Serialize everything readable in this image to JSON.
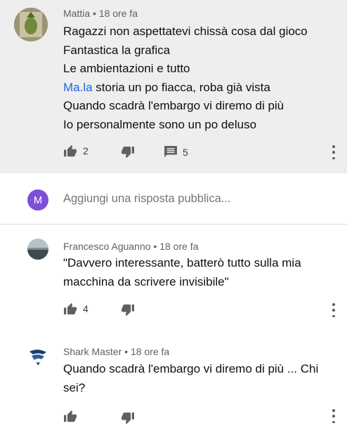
{
  "comments": [
    {
      "author": "Mattia",
      "time": "18 ore fa",
      "lines": [
        "Ragazzi non aspettatevi chissà cosa dal gioco",
        "Fantastica la grafica",
        "Le ambientazioni e tutto",
        "Ma.la storia un po fiacca, roba già vista",
        "Quando scadrà l'embargo vi diremo di più",
        "Io personalmente sono un po deluso"
      ],
      "link_text": "Ma.la",
      "line4_rest": " storia un po fiacca, roba già vista",
      "likes": "2",
      "replies": "5"
    },
    {
      "author": "Francesco Aguanno",
      "time": "18 ore fa",
      "lines": [
        "\"Davvero interessante, batterò tutto sulla mia",
        "macchina da scrivere invisibile\""
      ],
      "likes": "4"
    },
    {
      "author": "Shark Master",
      "time": "18 ore fa",
      "lines": [
        "Quando scadrà l'embargo vi diremo di più ... Chi",
        "sei?"
      ]
    }
  ],
  "reply": {
    "avatar_letter": "M",
    "placeholder": "Aggiungi una risposta pubblica..."
  },
  "separator": " • ",
  "colors": {
    "highlight_bg": "#eeeeee",
    "link": "#1a66d6",
    "reply_avatar": "#7d4fd6"
  },
  "icons": [
    "thumbs-up-icon",
    "thumbs-down-icon",
    "comment-icon",
    "more-vert-icon"
  ]
}
